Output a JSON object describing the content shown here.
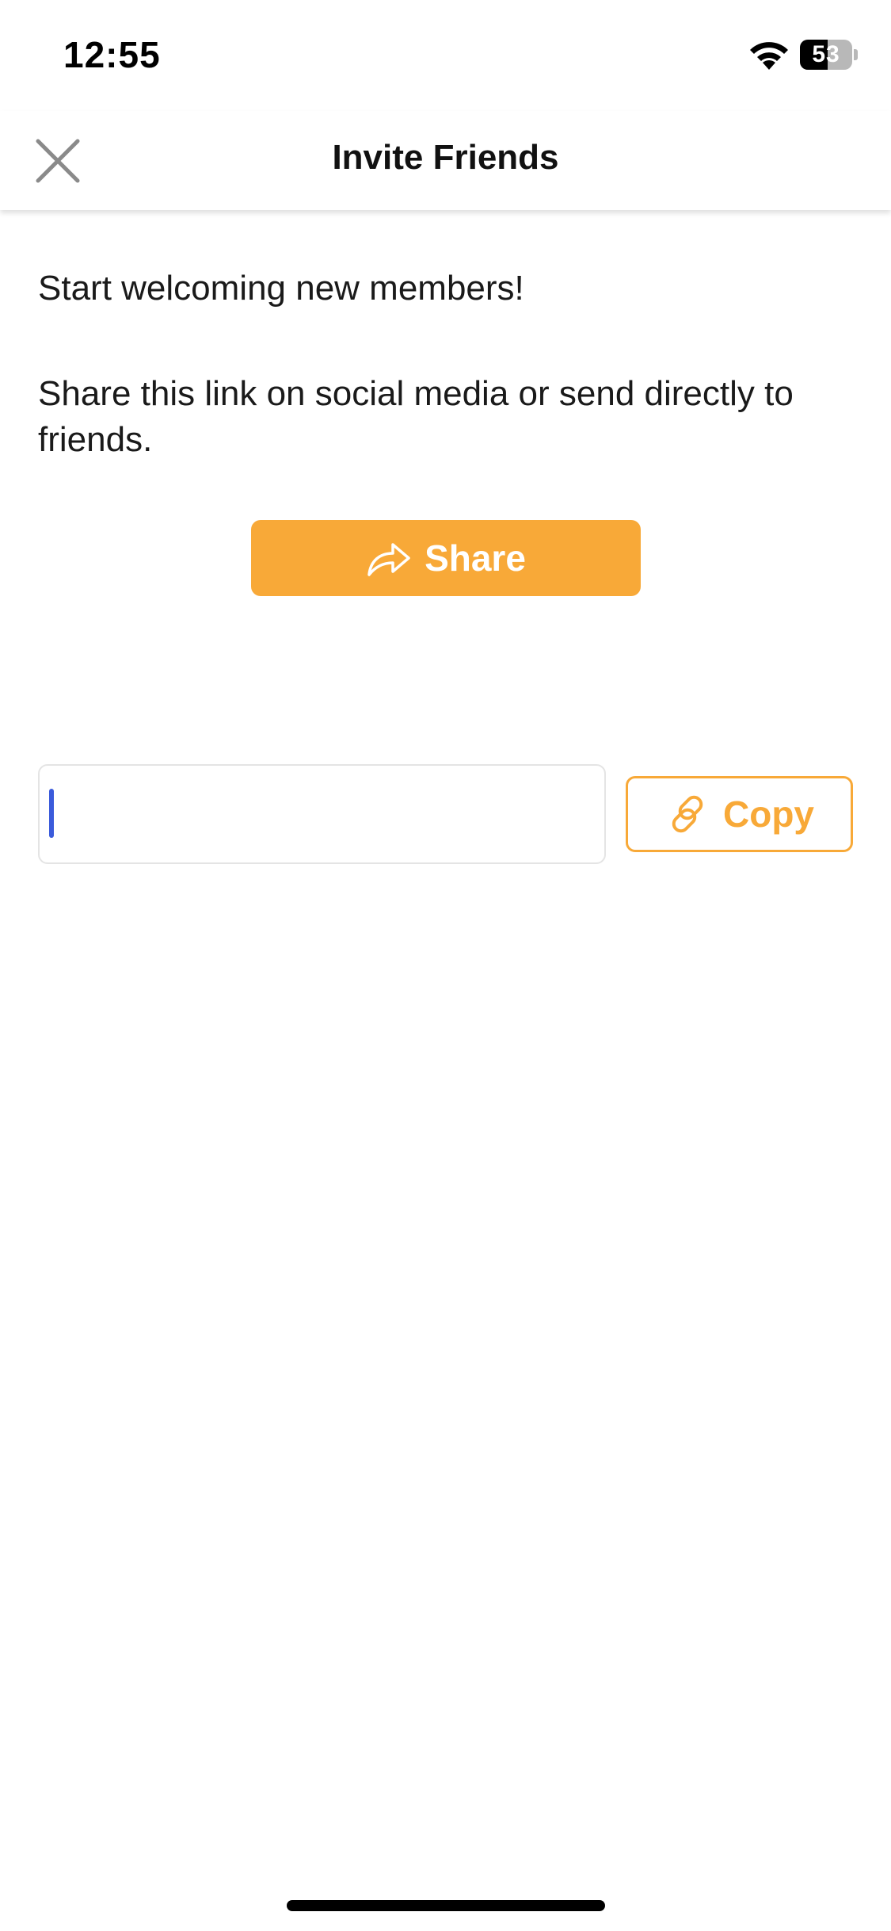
{
  "status_bar": {
    "time": "12:55",
    "battery_percent": 53,
    "battery_label": "53",
    "wifi_icon": "wifi-icon"
  },
  "nav": {
    "title": "Invite Friends",
    "close_icon": "close-icon"
  },
  "content": {
    "intro": "Start welcoming new members!",
    "instructions": "Share this link on social media or send directly to friends.",
    "share_button": {
      "label": "Share",
      "icon": "share-arrow-icon"
    },
    "link_field": {
      "value": "",
      "placeholder": ""
    },
    "copy_button": {
      "label": "Copy",
      "icon": "link-icon"
    }
  },
  "colors": {
    "accent": "#f8a938",
    "caret": "#3b5bdb",
    "text": "#1a1a1a"
  }
}
